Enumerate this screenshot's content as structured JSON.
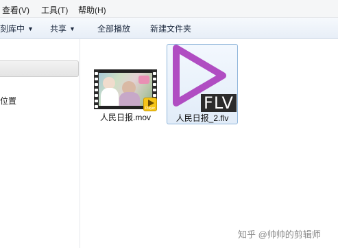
{
  "menubar": {
    "items": [
      {
        "label": "查看(V)"
      },
      {
        "label": "工具(T)"
      },
      {
        "label": "帮助(H)"
      }
    ]
  },
  "toolbar": {
    "include_library": "刻库中",
    "share": "共享",
    "play_all": "全部播放",
    "new_folder": "新建文件夹"
  },
  "nav": {
    "item_partial": "位置"
  },
  "files": [
    {
      "name": "人民日报.mov",
      "icon": "video-thumbnail",
      "badge": "Player"
    },
    {
      "name": "人民日报_2.flv",
      "icon": "flv-play-icon",
      "tag": "FLV",
      "accent": "#b04dc2"
    }
  ],
  "watermark": "知乎 @帅帅的剪辑师"
}
